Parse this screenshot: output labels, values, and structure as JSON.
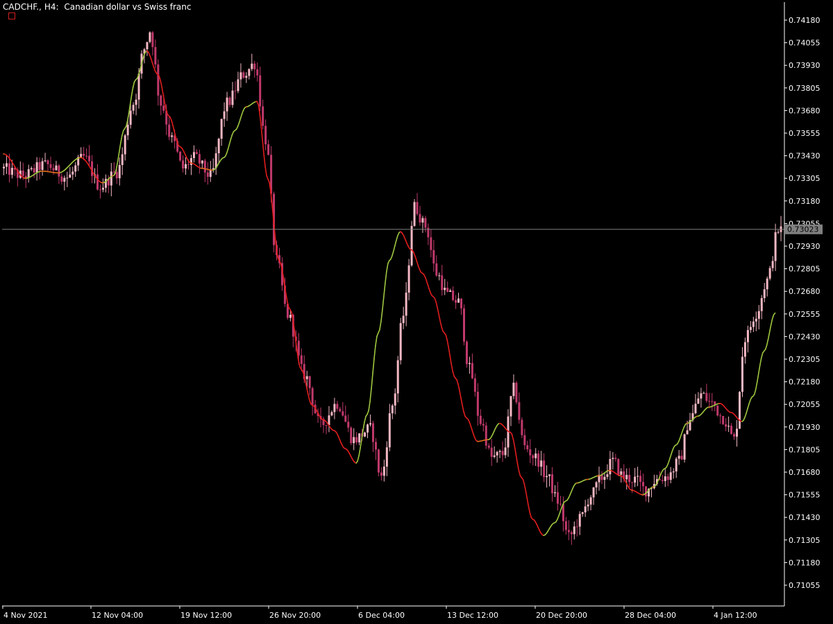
{
  "header": {
    "symbol": "CADCHF.,",
    "timeframe": "H4:",
    "description": "Canadian dollar vs Swiss franc"
  },
  "colors": {
    "background": "#000000",
    "axis": "#ffffff",
    "candle_up": "#f4b8c4",
    "candle_down": "#c0396b",
    "bid_line": "#808080",
    "badge_bg": "#808080",
    "ma_up": "#9dc63f",
    "ma_mid": "#e06a1c",
    "ma_down": "#e01d1d"
  },
  "current_price": "0.73023",
  "chart_data": {
    "type": "candlestick",
    "title": "CADCHF., H4: Canadian dollar vs Swiss franc",
    "ylim": [
      0.70993,
      0.74241
    ],
    "y_ticks": [
      "0.74180",
      "0.74055",
      "0.73930",
      "0.73805",
      "0.73680",
      "0.73555",
      "0.73430",
      "0.73305",
      "0.73180",
      "0.73055",
      "0.72930",
      "0.72805",
      "0.72680",
      "0.72555",
      "0.72430",
      "0.72305",
      "0.72180",
      "0.72055",
      "0.71930",
      "0.71805",
      "0.71680",
      "0.71555",
      "0.71430",
      "0.71305",
      "0.71180",
      "0.71055"
    ],
    "x_labels": [
      "4 Nov 2021",
      "12 Nov 04:00",
      "19 Nov 12:00",
      "26 Nov 20:00",
      "6 Dec 04:00",
      "13 Dec 12:00",
      "20 Dec 20:00",
      "28 Dec 04:00",
      "4 Jan 12:00"
    ],
    "price_anchors": [
      [
        0,
        0.7336
      ],
      [
        8,
        0.7332
      ],
      [
        16,
        0.7338
      ],
      [
        24,
        0.7331
      ],
      [
        30,
        0.7342
      ],
      [
        36,
        0.7326
      ],
      [
        42,
        0.7334
      ],
      [
        48,
        0.7372
      ],
      [
        52,
        0.7402
      ],
      [
        54,
        0.7412
      ],
      [
        58,
        0.7372
      ],
      [
        62,
        0.7352
      ],
      [
        66,
        0.7336
      ],
      [
        70,
        0.7342
      ],
      [
        76,
        0.7332
      ],
      [
        82,
        0.7372
      ],
      [
        88,
        0.7388
      ],
      [
        92,
        0.7394
      ],
      [
        96,
        0.7352
      ],
      [
        100,
        0.7285
      ],
      [
        104,
        0.7255
      ],
      [
        110,
        0.7222
      ],
      [
        116,
        0.7194
      ],
      [
        122,
        0.7206
      ],
      [
        128,
        0.7186
      ],
      [
        134,
        0.7192
      ],
      [
        138,
        0.7165
      ],
      [
        142,
        0.7205
      ],
      [
        146,
        0.7255
      ],
      [
        150,
        0.7315
      ],
      [
        154,
        0.7304
      ],
      [
        158,
        0.7278
      ],
      [
        162,
        0.7266
      ],
      [
        166,
        0.7262
      ],
      [
        170,
        0.7225
      ],
      [
        174,
        0.7196
      ],
      [
        178,
        0.7176
      ],
      [
        182,
        0.7178
      ],
      [
        186,
        0.7214
      ],
      [
        190,
        0.7182
      ],
      [
        194,
        0.7176
      ],
      [
        198,
        0.7166
      ],
      [
        202,
        0.7152
      ],
      [
        206,
        0.7132
      ],
      [
        210,
        0.7142
      ],
      [
        214,
        0.7155
      ],
      [
        218,
        0.7165
      ],
      [
        222,
        0.7174
      ],
      [
        226,
        0.7165
      ],
      [
        230,
        0.7164
      ],
      [
        234,
        0.7158
      ],
      [
        238,
        0.7164
      ],
      [
        242,
        0.7166
      ],
      [
        246,
        0.7174
      ],
      [
        250,
        0.7198
      ],
      [
        254,
        0.7211
      ],
      [
        258,
        0.7206
      ],
      [
        262,
        0.7198
      ],
      [
        266,
        0.7186
      ],
      [
        270,
        0.7242
      ],
      [
        274,
        0.7256
      ],
      [
        278,
        0.7274
      ],
      [
        282,
        0.7302
      ]
    ],
    "ma_anchors": [
      [
        0,
        0.7344
      ],
      [
        8,
        0.73305
      ],
      [
        14,
        0.73345
      ],
      [
        20,
        0.73335
      ],
      [
        28,
        0.7342
      ],
      [
        36,
        0.7328
      ],
      [
        40,
        0.7332
      ],
      [
        44,
        0.7358
      ],
      [
        48,
        0.7385
      ],
      [
        52,
        0.7401
      ],
      [
        56,
        0.7388
      ],
      [
        60,
        0.7365
      ],
      [
        64,
        0.7348
      ],
      [
        68,
        0.7339
      ],
      [
        72,
        0.7336
      ],
      [
        76,
        0.7335
      ],
      [
        80,
        0.7342
      ],
      [
        84,
        0.7357
      ],
      [
        88,
        0.737
      ],
      [
        92,
        0.7373
      ],
      [
        96,
        0.733
      ],
      [
        100,
        0.7285
      ],
      [
        104,
        0.7258
      ],
      [
        108,
        0.7225
      ],
      [
        112,
        0.7205
      ],
      [
        116,
        0.7197
      ],
      [
        120,
        0.7191
      ],
      [
        124,
        0.7181
      ],
      [
        128,
        0.7173
      ],
      [
        132,
        0.72
      ],
      [
        136,
        0.7245
      ],
      [
        140,
        0.7285
      ],
      [
        144,
        0.7301
      ],
      [
        148,
        0.7291
      ],
      [
        152,
        0.7278
      ],
      [
        156,
        0.7265
      ],
      [
        160,
        0.7245
      ],
      [
        164,
        0.722
      ],
      [
        168,
        0.7198
      ],
      [
        172,
        0.7185
      ],
      [
        176,
        0.7186
      ],
      [
        180,
        0.7195
      ],
      [
        184,
        0.719
      ],
      [
        188,
        0.7165
      ],
      [
        192,
        0.7142
      ],
      [
        196,
        0.7133
      ],
      [
        200,
        0.714
      ],
      [
        204,
        0.7152
      ],
      [
        208,
        0.7162
      ],
      [
        212,
        0.7164
      ],
      [
        216,
        0.7166
      ],
      [
        220,
        0.7169
      ],
      [
        224,
        0.7166
      ],
      [
        228,
        0.7158
      ],
      [
        232,
        0.71555
      ],
      [
        236,
        0.716
      ],
      [
        240,
        0.717
      ],
      [
        244,
        0.7183
      ],
      [
        248,
        0.7195
      ],
      [
        252,
        0.7199
      ],
      [
        256,
        0.7204
      ],
      [
        260,
        0.7206
      ],
      [
        264,
        0.7201
      ],
      [
        268,
        0.7196
      ],
      [
        272,
        0.721
      ],
      [
        276,
        0.7235
      ],
      [
        280,
        0.7256
      ]
    ]
  }
}
